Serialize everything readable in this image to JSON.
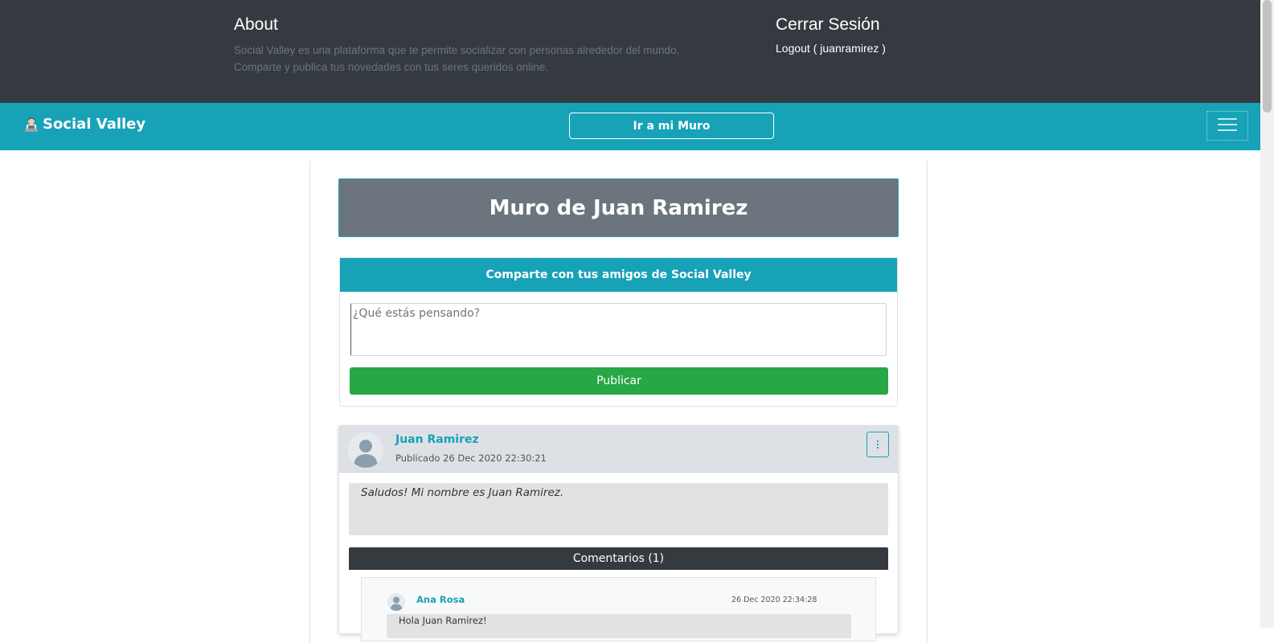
{
  "footer_panel": {
    "about_title": "About",
    "about_text": "Social Valley es una plataforma que te permite socializar con personas alrededor del mundo. Comparte y publica tus novedades con tus seres queridos online.",
    "logout_title": "Cerrar Sesión",
    "logout_link": "Logout ( juanramirez )"
  },
  "navbar": {
    "brand": "Social Valley",
    "brand_icon": "user-at-computer-icon",
    "wall_button": "Ir a mi Muro",
    "toggler_icon": "hamburger-menu-icon",
    "color": "#17a2b8"
  },
  "wall": {
    "title": "Muro de Juan Ramirez"
  },
  "share": {
    "header": "Comparte con tus amigos de Social Valley",
    "placeholder": "¿Qué estás pensando?",
    "publish_button": "Publicar"
  },
  "post": {
    "author": "Juan Ramirez",
    "date": "Publicado 26 Dec 2020 22:30:21",
    "body": "Saludos! Mi nombre es Juan Ramirez.",
    "comments_label": "Comentarios (1)",
    "comments": [
      {
        "author": "Ana Rosa",
        "date": "26 Dec 2020 22:34:28",
        "body": "Hola Juan Ramirez!"
      }
    ]
  },
  "colors": {
    "dark": "#343a40",
    "info": "#17a2b8",
    "success": "#28a745",
    "secondary": "#6c757d"
  }
}
